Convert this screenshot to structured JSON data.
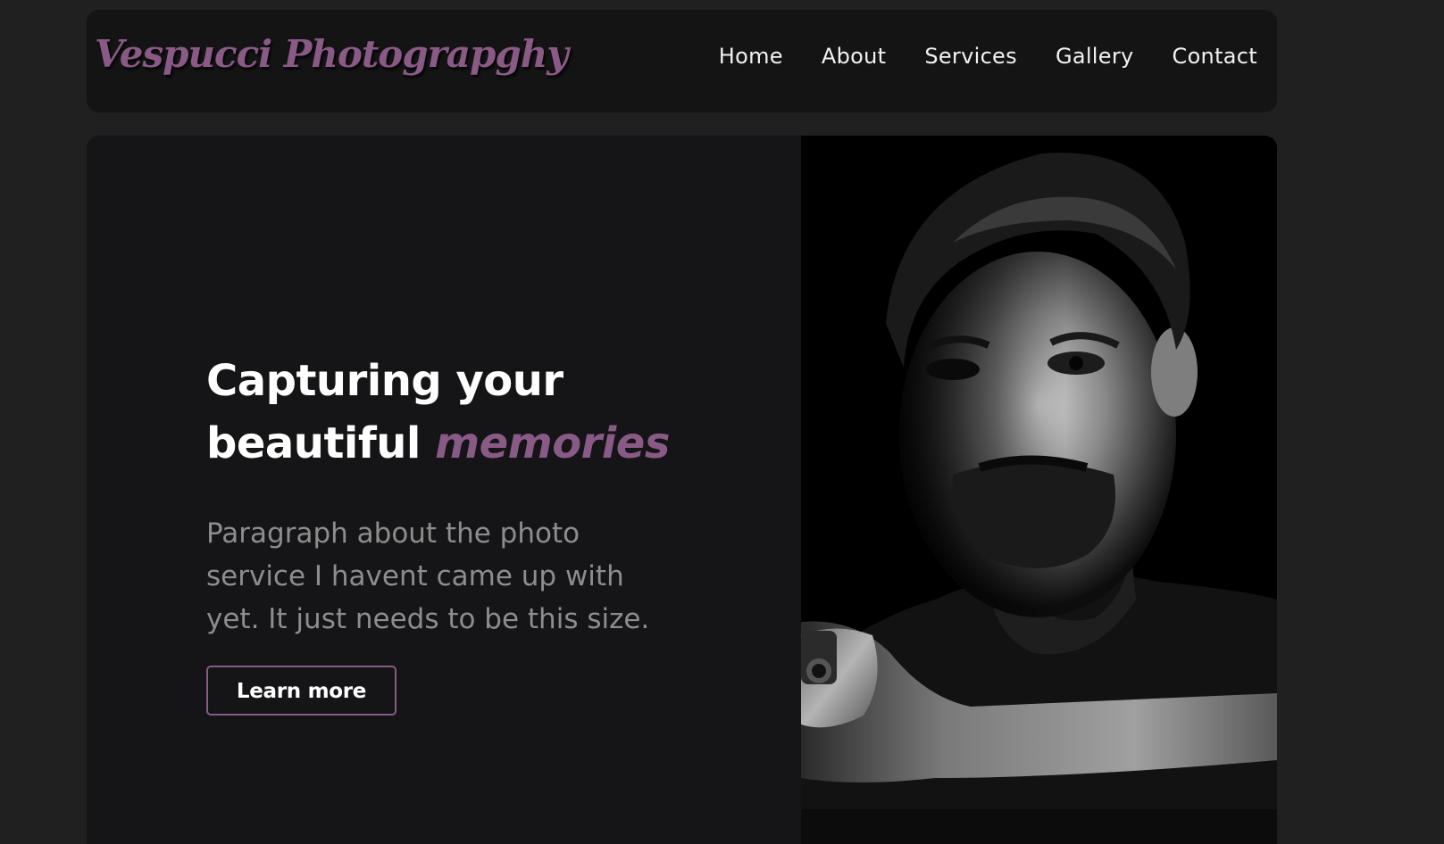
{
  "brand": {
    "logo_text": "Vespucci Photograpghy",
    "accent_color": "#8a5a86"
  },
  "nav": {
    "items": [
      {
        "label": "Home"
      },
      {
        "label": "About"
      },
      {
        "label": "Services"
      },
      {
        "label": "Gallery"
      },
      {
        "label": "Contact"
      }
    ]
  },
  "hero": {
    "headline_line1": "Capturing your",
    "headline_line2_prefix": "beautiful",
    "headline_accent": "memories",
    "paragraph": "Paragraph about the photo service I havent came up with yet. It just needs to be this size.",
    "cta_label": "Learn more",
    "photo_icon": "portrait-photo-icon"
  }
}
